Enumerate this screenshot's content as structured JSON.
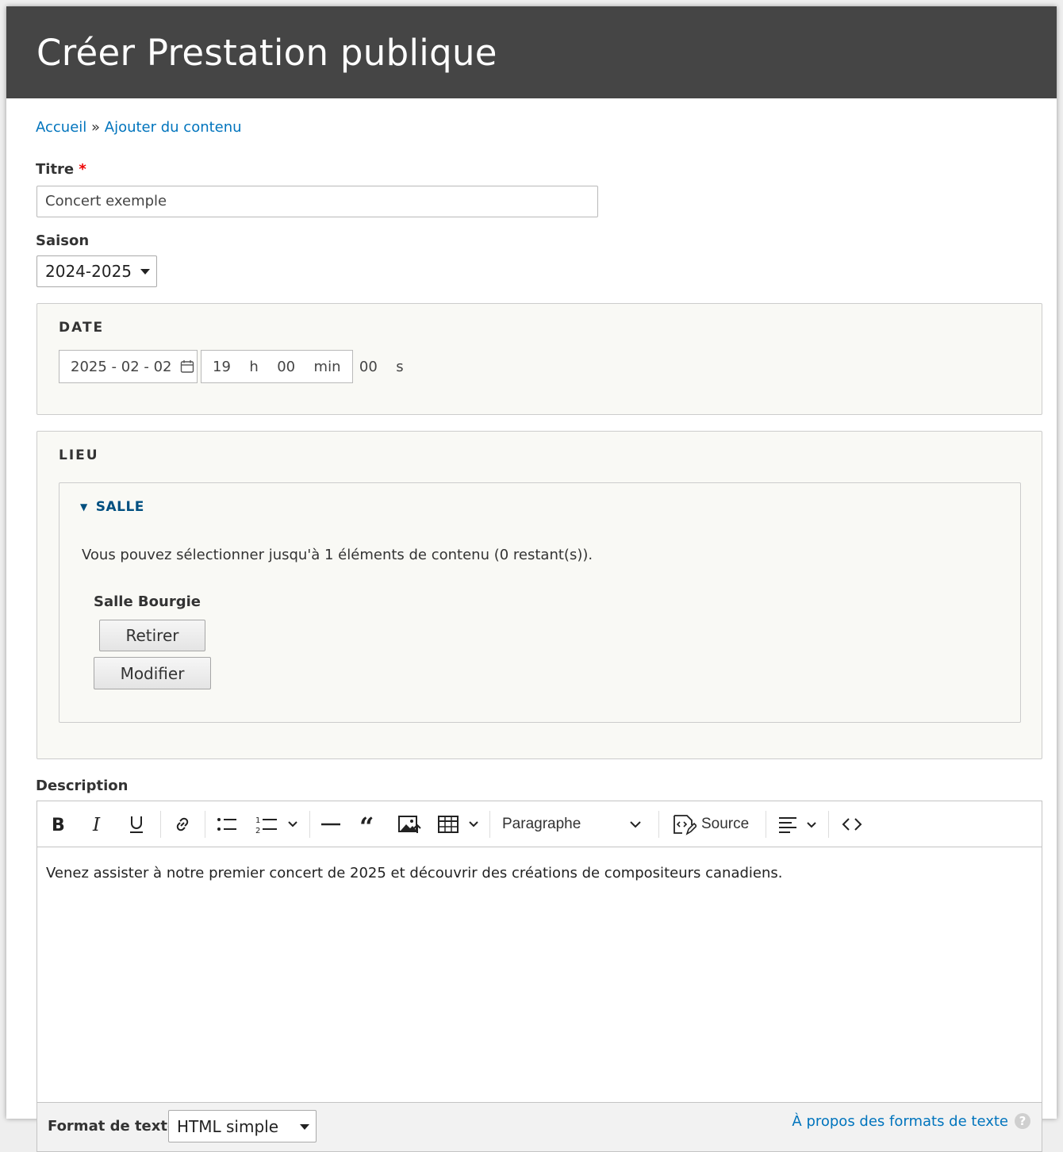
{
  "page": {
    "title": "Créer Prestation publique"
  },
  "breadcrumb": {
    "home": "Accueil",
    "separator": "»",
    "add_content": "Ajouter du contenu"
  },
  "fields": {
    "title": {
      "label": "Titre",
      "required_mark": "*",
      "value": "Concert exemple"
    },
    "season": {
      "label": "Saison",
      "value": "2024-2025"
    },
    "date": {
      "legend": "DATE",
      "date_value": "2025 - 02 - 02",
      "time_value": "19  h  00  min  00  s"
    },
    "lieu": {
      "legend": "LIEU",
      "salle": {
        "summary": "SALLE",
        "info": "Vous pouvez sélectionner jusqu'à 1 éléments de contenu (0 restant(s)).",
        "entity_label": "Salle Bourgie",
        "remove_button": "Retirer",
        "edit_button": "Modifier"
      }
    }
  },
  "description": {
    "label": "Description",
    "toolbar": {
      "icons": [
        "bold-icon",
        "italic-icon",
        "underline-icon",
        "link-icon",
        "bulleted-list-icon",
        "numbered-list-icon",
        "horizontal-line-icon",
        "block-quote-icon",
        "insert-image-icon",
        "insert-table-icon",
        "source-icon",
        "align-icon",
        "code-icon"
      ],
      "heading_select": "Paragraphe",
      "source_label": "Source"
    },
    "body": "Venez assister à notre premier concert de 2025 et découvrir des créations de compositeurs canadiens."
  },
  "text_format": {
    "label": "Format de texte",
    "value": "HTML simple",
    "about_link": "À propos des formats de texte",
    "help_icon": "?"
  },
  "colors": {
    "header_bg": "#454545",
    "link": "#0074bd",
    "summary": "#004f80",
    "required": "#e00000"
  }
}
